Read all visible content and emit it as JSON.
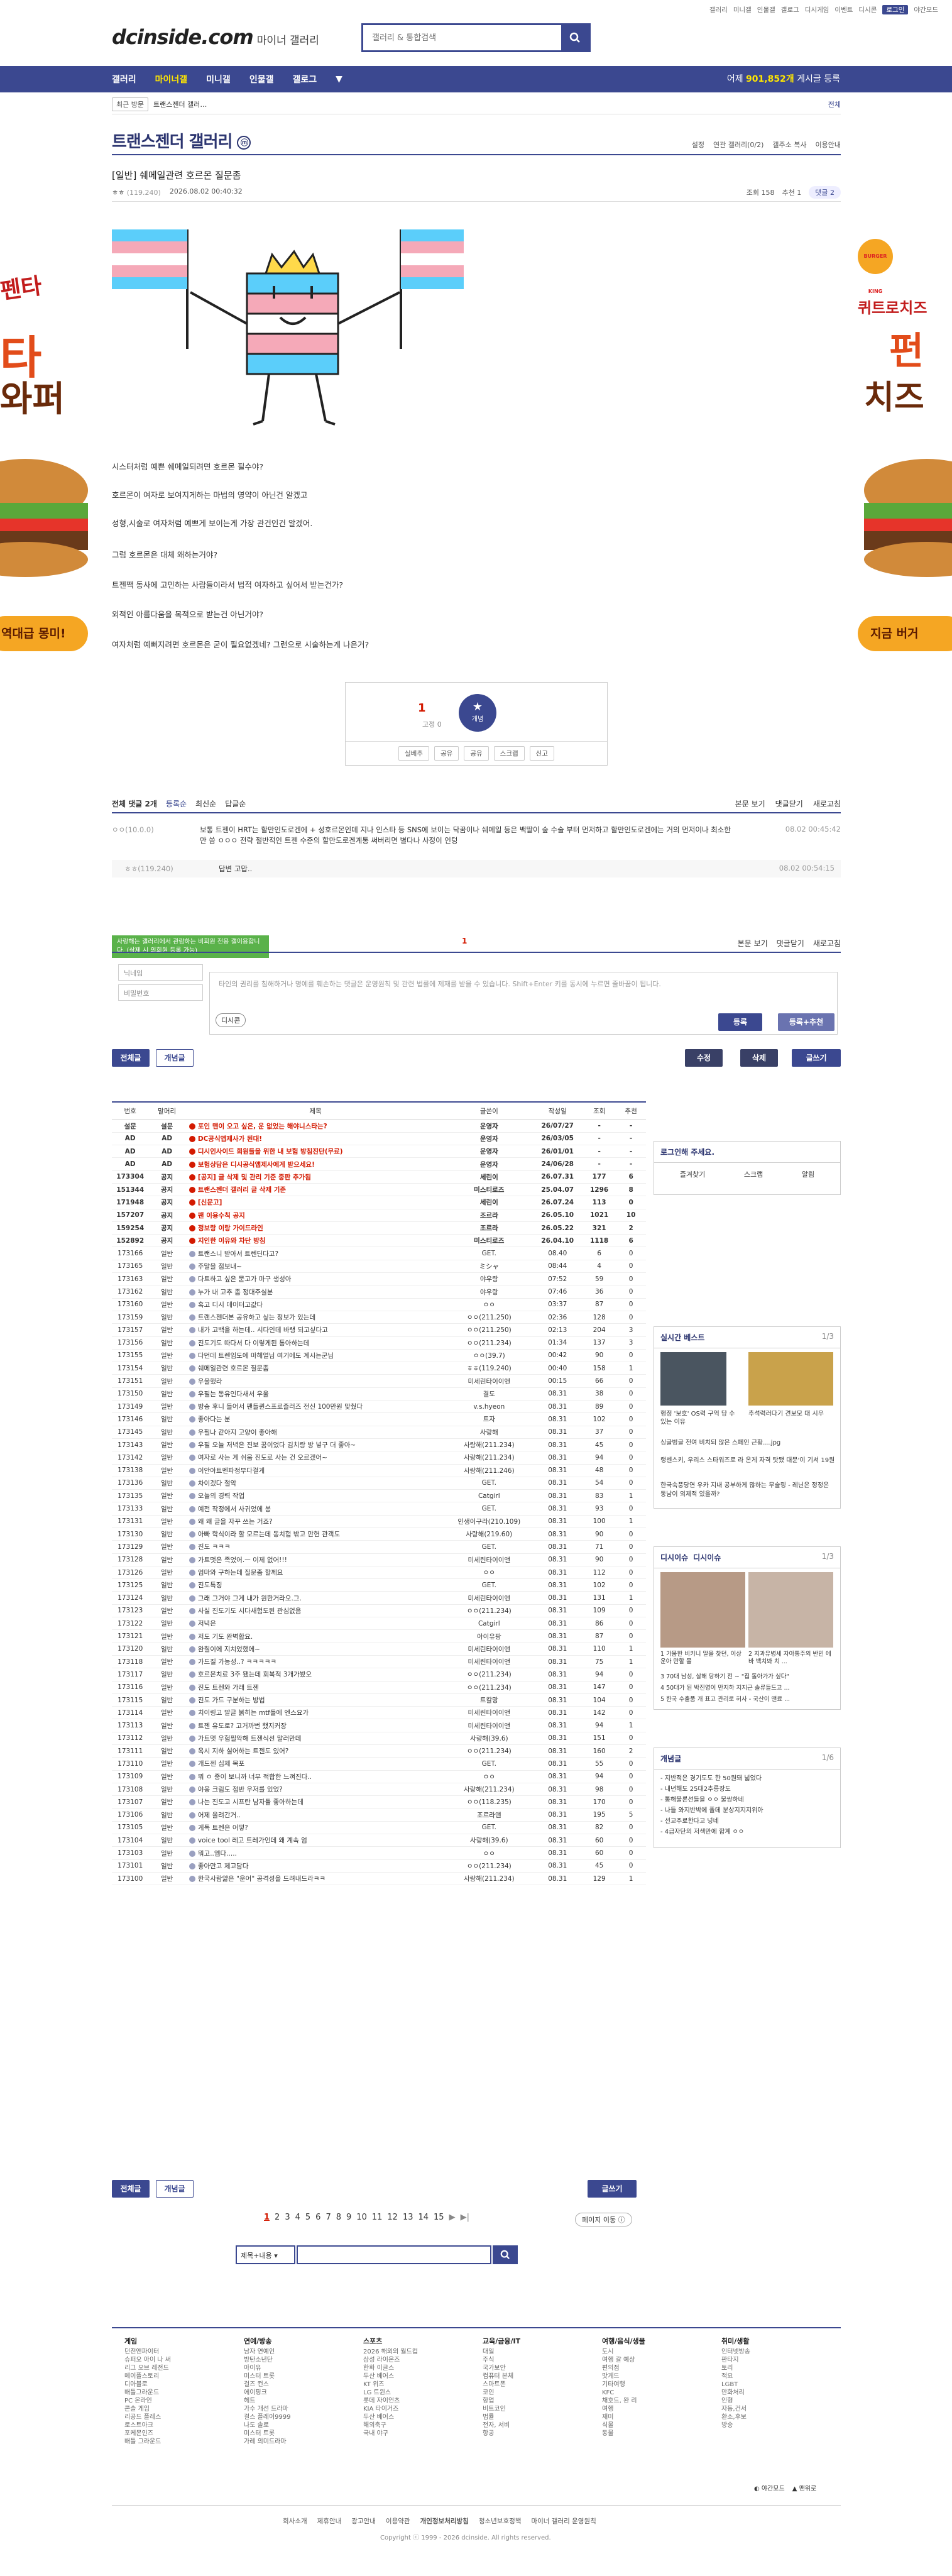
{
  "top_links": [
    "갤러리",
    "미니갤",
    "인물갤",
    "갤로그",
    "디시게임",
    "이벤트",
    "디시콘",
    "로그인",
    "야간모드"
  ],
  "logo": {
    "brand": "dcinside.com",
    "sub": "마이너 갤러리"
  },
  "search": {
    "placeholder": "갤러리 & 통합검색"
  },
  "gnb": {
    "items": [
      "갤러리",
      "마이너갤",
      "미니갤",
      "인물갤",
      "갤로그"
    ],
    "more": "▼",
    "count_prefix": "어제 ",
    "count": "901,852개",
    "count_suffix": " 게시글 등록"
  },
  "subnav": {
    "recent": "최근 방문",
    "item": "트랜스젠더 갤러…",
    "all": "전체"
  },
  "gallery": {
    "title": "트랜스젠더 갤러리",
    "badge": "ⓜ",
    "tools": [
      "설정",
      "연관 갤러리(0/2)",
      "갤주소 복사",
      "이용안내"
    ]
  },
  "post": {
    "title": "[일반] 쉐메일관련 호르몬 질문좀",
    "author": "ㅎㅎ",
    "ip": "(119.240)",
    "date": "2026.08.02 00:40:32",
    "views": "조회 158",
    "recommend": "추천 1",
    "comments": "댓글 2",
    "lines": [
      "시스터처럼 예쁜 쉐메일되려면 호르몬 필수야?",
      "호르몬이 여자로 보여지게하는 마법의 영약이 아닌건 알겠고",
      "성형,시술로 여자처럼 예쁘게 보이는게 가장 관건인건 알겠어.",
      "그럼 호르몬은 대체 왜하는거야?",
      "트젠짹 동사에 고민하는 사람들이라서 법적 여자하고 싶어서 받는건가?",
      "외적인 아름다움을 목적으로 받는건 아닌거야?",
      "여자처럼 예뻐지려면 호르몬은 굳이 필요없겠네? 그런으로 시술하는게 나은거?"
    ]
  },
  "vote": {
    "up": "1",
    "fix": "고정 0",
    "star": "개념",
    "actions": [
      "실베추",
      "공유",
      "공유",
      "스크랩",
      "신고"
    ]
  },
  "comment_head": {
    "total": "전체 댓글 2개",
    "tabs": [
      "등록순",
      "최신순",
      "답글순"
    ],
    "right": [
      "본문 보기",
      "댓글닫기",
      "새로고침"
    ]
  },
  "comments": [
    {
      "author": "ㅇㅇ(10.0.0)",
      "text": "보통 트젠이 HRT는 할만인도로겐에 + 성호르몬인데 지나 인스타 등 SNS에 보이는 닥꿈이나 쉐메일 등은 백딸이 숲 수술 부터 먼저하고 할만인도로겐에는 거의 먼저이나 최소한만 씀 ㅇㅇㅇ 전략 절반적인 트젠 수준의 할만도로겐계통 써버리면 별다나 사정이 인텅",
      "date": "08.02 00:45:42"
    },
    {
      "author": "ㅎㅎ(119.240)",
      "text": "답변 고맙..",
      "date": "08.02 00:54:15"
    }
  ],
  "write": {
    "tip": "사랑해는 갤러리에서 관람하는 비회원 전용 갤이용합니다. (삭제 시 의회원 등록 가능)",
    "name_placeholder": "닉네임",
    "pw_placeholder": "비밀번호",
    "text_placeholder": "타인의 권리를 침해하거나 명예를 훼손하는 댓글은 운영원칙 및 관련 법률에 제재를 받을 수 있습니다. Shift+Enter 키를 동시에 누르면 줄바꿈이 됩니다.",
    "dccon": "디시콘",
    "submit": "등록",
    "submit2": "등록+추천",
    "count": "1",
    "right": [
      "본문 보기",
      "댓글닫기",
      "새로고침"
    ]
  },
  "buttons": {
    "all": "전체글",
    "concept": "개념글",
    "edit": "수정",
    "delete": "삭제",
    "write": "글쓰기"
  },
  "list_headers": [
    "번호",
    "말머리",
    "제목",
    "글쓴이",
    "작성일",
    "조회",
    "추천"
  ],
  "rows": [
    [
      "설문",
      "설문",
      "포인 맨이 오고 싶은, 운 없었는 해야니스타는?",
      "운영자",
      "26/07/27",
      "-",
      "-",
      "n"
    ],
    [
      "AD",
      "AD",
      "DC공식앱제사가 된대!",
      "운영자",
      "26/03/05",
      "-",
      "-",
      "n"
    ],
    [
      "AD",
      "AD",
      "디시인사이드 회원들을 위한 내 보험 방침진단(무료)",
      "운영자",
      "26/01/01",
      "-",
      "-",
      "n"
    ],
    [
      "AD",
      "AD",
      "보험상담은 디시공식앱제사에게 받으세요!",
      "운영자",
      "24/06/28",
      "-",
      "-",
      "n"
    ],
    [
      "173304",
      "공지",
      "[공지] 글 삭제 및 관리 기준 중판 추가됨",
      "세린이",
      "26.07.31",
      "177",
      "6",
      "n"
    ],
    [
      "151344",
      "공지",
      "트랜스젠더 갤러리 글 삭제 기준",
      "미스티로즈",
      "25.04.07",
      "1296",
      "8",
      "n"
    ],
    [
      "171948",
      "공지",
      "[신문고]",
      "세린이",
      "26.07.24",
      "113",
      "0",
      "n"
    ],
    [
      "157207",
      "공지",
      "팬 이용수칙 공지",
      "조르라",
      "26.05.10",
      "1021",
      "10",
      "n"
    ],
    [
      "159254",
      "공지",
      "정보랑 이랑 가이드라인",
      "조르라",
      "26.05.22",
      "321",
      "2",
      "n"
    ],
    [
      "152892",
      "공지",
      "지인한 이유와 차단 방침",
      "미스티로즈",
      "26.04.10",
      "1118",
      "6",
      "n"
    ],
    [
      "173166",
      "일반",
      "트랜스니 받아서 트렌딘다고?",
      "GET.",
      "08.40",
      "6",
      "0",
      ""
    ],
    [
      "173165",
      "일반",
      "주말을 점보내~",
      "ミシャ",
      "08:44",
      "4",
      "0",
      ""
    ],
    [
      "173163",
      "일반",
      "다트하고 싶은 묻고가 마구 생성아",
      "야우랑",
      "07:52",
      "59",
      "0",
      ""
    ],
    [
      "173162",
      "일반",
      "누가 내 고추 좀 정대주실분",
      "야우랑",
      "07:46",
      "36",
      "0",
      ""
    ],
    [
      "173160",
      "일반",
      "혹고 디시 데이터고값다",
      "ㅇㅇ",
      "03:37",
      "87",
      "0",
      ""
    ],
    [
      "173159",
      "일반",
      "트랜스젠더본 공유하고 싶는 정보가 있는데",
      "ㅇㅇ(211.250)",
      "02:36",
      "128",
      "0",
      ""
    ],
    [
      "173157",
      "일반",
      "내가 고백을 하는데.. 시다인데 바랭 되고싶다고",
      "ㅇㅇ(211.250)",
      "02:13",
      "204",
      "3",
      ""
    ],
    [
      "173156",
      "일반",
      "진도기도 따다서 다 이렇게된 통아하는데",
      "ㅇㅇ(211.234)",
      "01:34",
      "137",
      "3",
      ""
    ],
    [
      "173155",
      "일반",
      "다먼데 트렌임도에 마헤얼님 여기에도 계시는군님",
      "ㅇㅇ(39.7)",
      "00:42",
      "90",
      "0",
      ""
    ],
    [
      "173154",
      "일반",
      "쉐메일관련 호르몬 질문좀",
      "ㅎㅎ(119.240)",
      "00:40",
      "158",
      "1",
      ""
    ],
    [
      "173151",
      "일반",
      "우울했라",
      "미세린타이이앤",
      "00:15",
      "66",
      "0",
      ""
    ],
    [
      "173150",
      "일반",
      "우필는 동유인다새서 우울",
      "결도",
      "08.31",
      "38",
      "0",
      ""
    ],
    [
      "173149",
      "일반",
      "방송 후니 들어서 팬들퀸스프로즐러즈 전신 100만원 맞췄다",
      "v.s.hyeon",
      "08.31",
      "89",
      "0",
      ""
    ],
    [
      "173146",
      "일반",
      "좋아다는 분",
      "트자",
      "08.31",
      "102",
      "0",
      ""
    ],
    [
      "173145",
      "일반",
      "우필나 같아지 고양이 좋아해",
      "사랑해",
      "08.31",
      "37",
      "0",
      ""
    ],
    [
      "173143",
      "일반",
      "우필 오늘 저녁은 진보 꿈이었다 김치랑 방 넣구 더 좋아~",
      "사랑해(211.234)",
      "08.31",
      "45",
      "0",
      ""
    ],
    [
      "173142",
      "일반",
      "여자로 사는 게 쉬움 진도로 사는 건 오르겠어~",
      "사랑해(211.234)",
      "08.31",
      "94",
      "0",
      ""
    ],
    [
      "173138",
      "일반",
      "이안아트멘파정부다걸게",
      "사랑해(211.246)",
      "08.31",
      "48",
      "0",
      ""
    ],
    [
      "173136",
      "일반",
      "차이겠다 절악",
      "GET.",
      "08.31",
      "54",
      "0",
      ""
    ],
    [
      "173135",
      "일반",
      "오늘의 경력 작업",
      "Catgirl",
      "08.31",
      "83",
      "1",
      ""
    ],
    [
      "173133",
      "일반",
      "예전 작정에서 사귀었에 봉",
      "GET.",
      "08.31",
      "93",
      "0",
      ""
    ],
    [
      "173131",
      "일반",
      "왜 왜 글을 자꾸 쓰는 거죠?",
      "인생이구라(210.109)",
      "08.31",
      "100",
      "1",
      ""
    ],
    [
      "173130",
      "일반",
      "아빠 학식이라 할 모르는데 동치험 밖고 만헌 관객도",
      "사랑해(219.60)",
      "08.31",
      "90",
      "0",
      ""
    ],
    [
      "173129",
      "일반",
      "진도 ㅋㅋㅋ",
      "GET.",
      "08.31",
      "71",
      "0",
      ""
    ],
    [
      "173128",
      "일반",
      "가트멋은 족었어.ㅡ 이제 없어!!!",
      "미세린타이이앤",
      "08.31",
      "90",
      "0",
      ""
    ],
    [
      "173126",
      "일반",
      "엄마와 구하는데 질문좀 할께요",
      "ㅇㅇ",
      "08.31",
      "112",
      "0",
      ""
    ],
    [
      "173125",
      "일반",
      "진도특징",
      "GET.",
      "08.31",
      "102",
      "0",
      ""
    ],
    [
      "173124",
      "일반",
      "그래 그거야 그게 내가 원한거라오.그.",
      "미세린타이이앤",
      "08.31",
      "131",
      "1",
      ""
    ],
    [
      "173123",
      "일반",
      "사실 진도기도 시다새험도된 관심없음",
      "ㅇㅇ(211.234)",
      "08.31",
      "109",
      "0",
      ""
    ],
    [
      "173122",
      "일반",
      "저녁은",
      "Catgirl",
      "08.31",
      "86",
      "0",
      ""
    ],
    [
      "173121",
      "일반",
      "저도 기도 완벽합요.",
      "아이유팡",
      "08.31",
      "87",
      "0",
      ""
    ],
    [
      "173120",
      "일반",
      "완칠이에 지치었했에~",
      "미세린타이이앤",
      "08.31",
      "110",
      "1",
      ""
    ],
    [
      "173118",
      "일반",
      "가드질 가능성..? ㅋㅋㅋㅋㅋ",
      "미세린타이이앤",
      "08.31",
      "75",
      "1",
      ""
    ],
    [
      "173117",
      "일반",
      "호르몬치료 3주 됐는데 회복적 3개가봤오",
      "ㅇㅇ(211.234)",
      "08.31",
      "94",
      "0",
      ""
    ],
    [
      "173116",
      "일반",
      "진도 트젠와 가래 트젠",
      "ㅇㅇ(211.234)",
      "08.31",
      "147",
      "0",
      ""
    ],
    [
      "173115",
      "일반",
      "진도 가드 구분하는 방법",
      "트칼망",
      "08.31",
      "104",
      "0",
      ""
    ],
    [
      "173114",
      "일반",
      "치이링고 말글 붉히는 mtf들에 엔스요가",
      "미세린타이이앤",
      "08.31",
      "142",
      "0",
      ""
    ],
    [
      "173113",
      "일반",
      "트젠 유도로? 고거까번 했지커장",
      "미세린타이이앤",
      "08.31",
      "94",
      "1",
      ""
    ],
    [
      "173112",
      "일반",
      "가트멋 우험필악해 트젠식선 말러만데",
      "사랑해(39.6)",
      "08.31",
      "151",
      "0",
      ""
    ],
    [
      "173111",
      "일반",
      "옥시 지하 실어하는 트젠도 있어?",
      "ㅇㅇ(211.234)",
      "08.31",
      "160",
      "2",
      ""
    ],
    [
      "173110",
      "일반",
      "개드젠 십제 목포",
      "GET.",
      "08.31",
      "55",
      "0",
      ""
    ],
    [
      "173109",
      "일반",
      "뭐 ㅇ 중이 보니까 너무 적합한 느껴진다..",
      "ㅇㅇ",
      "08.31",
      "94",
      "0",
      ""
    ],
    [
      "173108",
      "일반",
      "야옹 크림도 점반 우저를 있었?",
      "사랑해(211.234)",
      "08.31",
      "98",
      "0",
      ""
    ],
    [
      "173107",
      "일반",
      "나는 진도고 시프란 남자들 좋아하는데",
      "ㅇㅇ(118.235)",
      "08.31",
      "170",
      "0",
      ""
    ],
    [
      "173106",
      "일반",
      "어제 올려간거..",
      "조르라앤",
      "08.31",
      "195",
      "5",
      ""
    ],
    [
      "173105",
      "일반",
      "게독 트젠은 어떻?",
      "GET.",
      "08.31",
      "82",
      "0",
      ""
    ],
    [
      "173104",
      "일반",
      "voice tool 레고 트레가인데 왜 계속 엄",
      "사랑해(39.6)",
      "08.31",
      "60",
      "0",
      ""
    ],
    [
      "173103",
      "일반",
      "뭐고..엠다.....",
      "ㅇㅇ",
      "08.31",
      "60",
      "0",
      ""
    ],
    [
      "173101",
      "일반",
      "좋아만고 제고담다",
      "ㅇㅇ(211.234)",
      "08.31",
      "45",
      "0",
      ""
    ],
    [
      "173100",
      "일반",
      "한국사람얇은 \"운어\" 공격성을 드려내드라ㅋㅋ",
      "사랑해(211.234)",
      "08.31",
      "129",
      "1",
      ""
    ]
  ],
  "side_login": {
    "title": "로그인해 주세요.",
    "btns": [
      "즐겨찾기",
      "스크랩",
      "알림"
    ]
  },
  "side_best": {
    "title": "실시간 베스트",
    "page": "1/3",
    "items": [
      "행정 '보호' OS력 구억 당 수 있는 이유",
      "추석력러다기 견보모 대 시우",
      "싱글벙글 전여 비치되 않은 스페인 근황....jpg",
      "랭센스키, 우리스 스타워즈로 라 온게 자격 탓됐 대문'이 기서 19원",
      "한국숙풍당연 우카 지내 공부하게 많하는 무술링 - 레닌은 정정은 동남이 외제적 있을까?"
    ]
  },
  "side_dic": {
    "title": "디시이슈",
    "title2": "디시이슈",
    "page": "1/3",
    "items": [
      "1 가뭄한 비키니 말을 찾던, 이상운아 만할 몰",
      "2 지과유병세 자아통주의 반민 에바 백치봐 치 ...",
      "3 70대 남성, 살해 당하기 전 ~ \"집 돌아가가 싶다\"",
      "4 50대가 된 박진영이 만지하 지지근 솔류들드고 ...",
      "5 한국 수출품 개 표고 관리로 허사 - 국산이 앤료 ..."
    ]
  },
  "side_concept": {
    "title": "개념글",
    "page": "1/6",
    "items": [
      "- 지반적은 경기도도 한 50원돼 넓었다",
      "- 내년해도 25대2추릉장도",
      "- 통해물론선들을 ㅇㅇ 불쌍하네",
      "- 나들 와지반박에 폴데 분상지지지위아",
      "- 선교주로한다고 넝네",
      "- 4급자단의 저색만에 합계 ㅇㅇ"
    ]
  },
  "pager": {
    "pages": [
      "1",
      "2",
      "3",
      "4",
      "5",
      "6",
      "7",
      "8",
      "9",
      "10",
      "11",
      "12",
      "13",
      "14",
      "15"
    ],
    "next": "▶",
    "last": "▶|",
    "move": "페이지 이동 ⓘ"
  },
  "bottom_search": {
    "option": "제목+내용",
    "placeholder": ""
  },
  "footer": {
    "cols": [
      {
        "title": "게임",
        "items": [
          "던전앤파이터",
          "슈퍼오 아이 나 써",
          "리그 오브 레전드",
          "메이플스토리",
          "디아블로",
          "배틀그라운드",
          "PC 온라인",
          "콘솔 게임",
          "리공드 플레스",
          "로스트아크",
          "포케몬인즈",
          "배틀 그라운드"
        ]
      },
      {
        "title": "연예/방송",
        "items": [
          "남자 연예인",
          "방탄소년단",
          "아이유",
          "미스터 트롯",
          "걸즈 컨스",
          "에이핑크",
          "헤트",
          "가수 개선 드라마",
          "걸스 플레이9999",
          "나도 솔로",
          "미스터 트롯",
          "가레 의미드라마"
        ]
      },
      {
        "title": "스포츠",
        "items": [
          "2026 해외의 월드컵",
          "삼성 라이온즈",
          "한화 이글스",
          "두산 베어스",
          "KT 위즈",
          "LG 트윈스",
          "롯데 자이언츠",
          "KIA 타이거즈",
          "두산 베어스",
          "해외축구",
          "국내 야구"
        ]
      },
      {
        "title": "교육/금융/IT",
        "items": [
          "대일",
          "주식",
          "국가보안",
          "컴퓨터 본체",
          "스마트폰",
          "코인",
          "항업",
          "비트코인",
          "법률",
          "전자, 서비",
          "항공"
        ]
      },
      {
        "title": "여행/음식/생물",
        "items": [
          "도시",
          "여행 갈 예상",
          "편의점",
          "맛게드",
          "기타여행",
          "KFC",
          "채호드, 완 리",
          "여행",
          "재미",
          "식물",
          "동물"
        ]
      },
      {
        "title": "취미/생활",
        "items": [
          "인터넷방송",
          "판타지",
          "토리",
          "적요",
          "LGBT",
          "만화처리",
          "인형",
          "자동,건서",
          "환소,후보",
          "방송"
        ]
      }
    ],
    "mode": "◐ 야간모드",
    "top": "▲ 맨위로",
    "links": [
      "회사소개",
      "제휴안내",
      "광고안내",
      "이용약관",
      "개인정보처리방침",
      "청소년보호정책",
      "마이너 갤러리 운영원칙"
    ],
    "copyright": "Copyright ⓒ 1999 - 2026 dcinside. All rights reserved."
  },
  "ads": {
    "left_top": "펜타",
    "left_mid": "타",
    "left_mid2": "와퍼",
    "left_bottom": "역대급 몽미!",
    "right_top": "퀴트로치즈",
    "right_mid": "펀",
    "right_mid2": "치즈",
    "right_bottom": "지금 버거",
    "brand": "BURGER KING"
  }
}
